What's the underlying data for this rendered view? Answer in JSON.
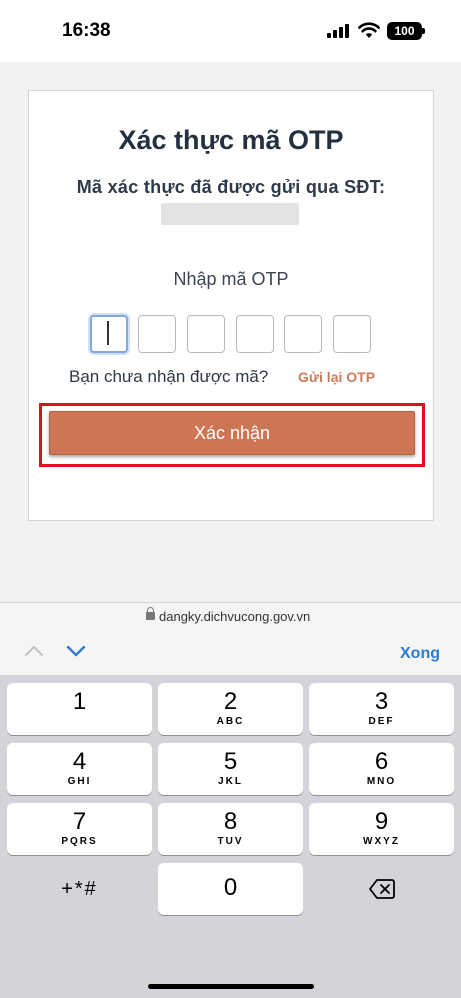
{
  "status_bar": {
    "time": "16:38",
    "battery": "100"
  },
  "page": {
    "title": "Xác thực mã OTP",
    "subtitle": "Mã xác thực đã được gửi qua SĐT:",
    "otp_label": "Nhập mã OTP",
    "otp_digits": [
      "",
      "",
      "",
      "",
      "",
      ""
    ],
    "resend_question": "Bạn chưa nhận được mã?",
    "resend_link": "Gửi lại OTP",
    "confirm_button": "Xác nhận"
  },
  "browser": {
    "url": "dangky.dichvucong.gov.vn"
  },
  "accessory": {
    "done_label": "Xong"
  },
  "keypad": {
    "keys": [
      {
        "num": "1",
        "letters": ""
      },
      {
        "num": "2",
        "letters": "ABC"
      },
      {
        "num": "3",
        "letters": "DEF"
      },
      {
        "num": "4",
        "letters": "GHI"
      },
      {
        "num": "5",
        "letters": "JKL"
      },
      {
        "num": "6",
        "letters": "MNO"
      },
      {
        "num": "7",
        "letters": "PQRS"
      },
      {
        "num": "8",
        "letters": "TUV"
      },
      {
        "num": "9",
        "letters": "WXYZ"
      }
    ],
    "symbols": "+*#",
    "zero": "0",
    "delete_icon": "backspace-icon"
  },
  "colors": {
    "accent": "#cc7656",
    "highlight": "#d9141c",
    "link": "#cf7a58",
    "done": "#2f7ad2"
  }
}
